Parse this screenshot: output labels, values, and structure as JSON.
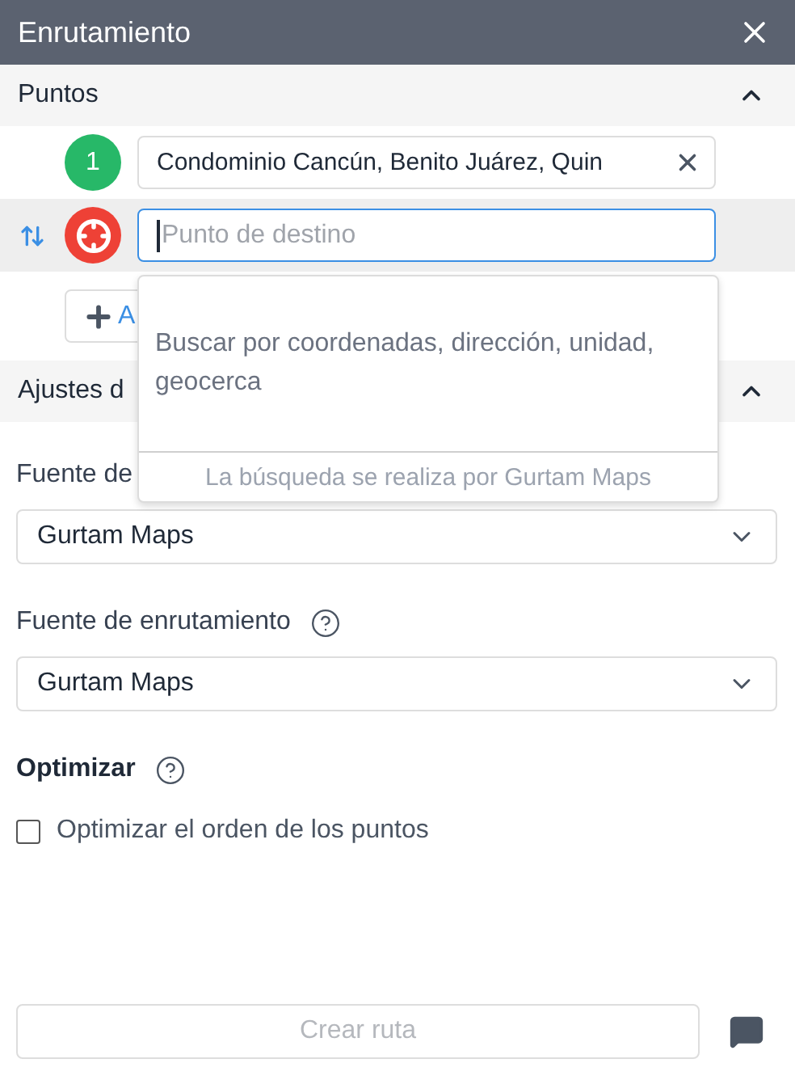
{
  "window": {
    "title": "Enrutamiento"
  },
  "points_section": {
    "title": "Puntos",
    "expanded": true
  },
  "points": [
    {
      "kind": "numbered",
      "badge": "1",
      "value": "Condominio Cancún, Benito Juárez, Quin",
      "active": false
    },
    {
      "kind": "destination",
      "placeholder": "Punto de destino",
      "active": true
    }
  ],
  "add_button": {
    "label": "A"
  },
  "dropdown": {
    "hint": "Buscar por coordenadas, dirección, unidad, geocerca",
    "footer": "La búsqueda se realiza por Gurtam Maps"
  },
  "settings_section": {
    "title": "Ajustes d",
    "expanded": true
  },
  "selects": [
    {
      "label": "Fuente de",
      "value": "Gurtam Maps"
    },
    {
      "label": "Fuente de enrutamiento",
      "value": "Gurtam Maps",
      "help": true
    }
  ],
  "optimize": {
    "title": "Optimizar",
    "help": true,
    "options": [
      {
        "label": "Optimizar el orden de los puntos",
        "checked": false
      }
    ]
  },
  "create_button": {
    "label": "Crear ruta",
    "disabled": true
  }
}
